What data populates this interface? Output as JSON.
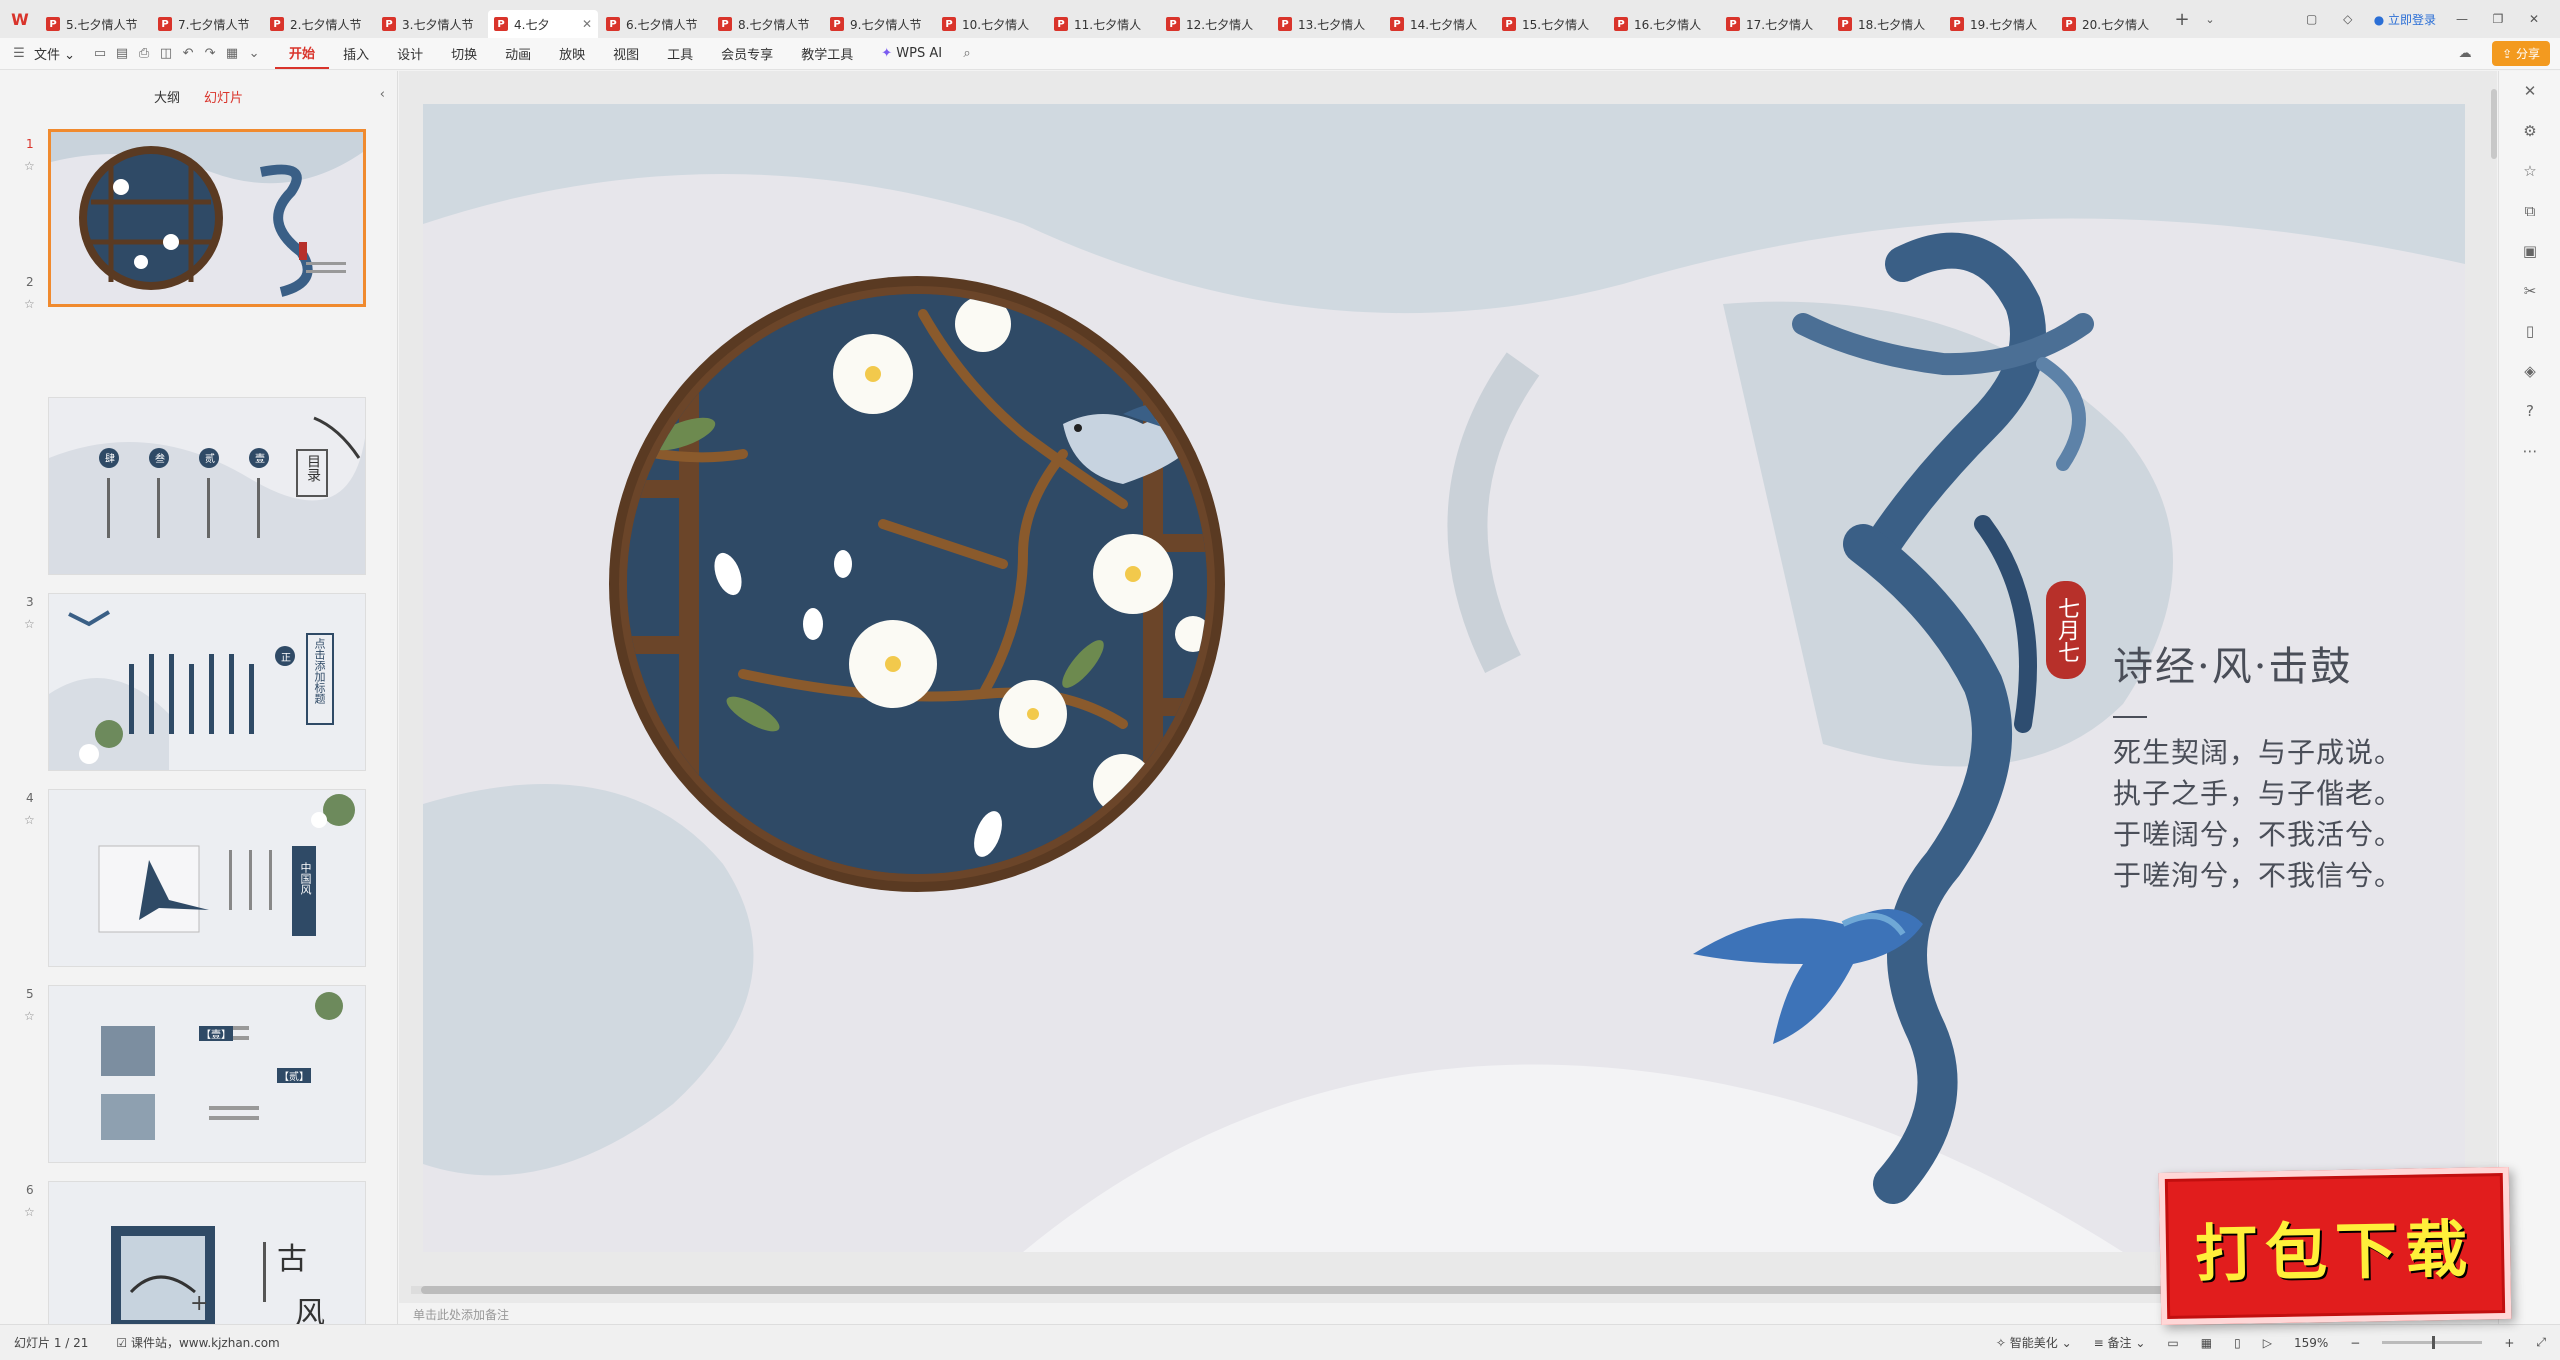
{
  "tabs": [
    {
      "label": "5.七夕情人节"
    },
    {
      "label": "7.七夕情人节"
    },
    {
      "label": "2.七夕情人节"
    },
    {
      "label": "3.七夕情人节"
    },
    {
      "label": "4.七夕"
    },
    {
      "label": "6.七夕情人节"
    },
    {
      "label": "8.七夕情人节"
    },
    {
      "label": "9.七夕情人节"
    },
    {
      "label": "10.七夕情人"
    },
    {
      "label": "11.七夕情人"
    },
    {
      "label": "12.七夕情人"
    },
    {
      "label": "13.七夕情人"
    },
    {
      "label": "14.七夕情人"
    },
    {
      "label": "15.七夕情人"
    },
    {
      "label": "16.七夕情人"
    },
    {
      "label": "17.七夕情人"
    },
    {
      "label": "18.七夕情人"
    },
    {
      "label": "19.七夕情人"
    },
    {
      "label": "20.七夕情人"
    }
  ],
  "titlebar": {
    "login": "立即登录"
  },
  "menu": {
    "file": "文件",
    "items": [
      "开始",
      "插入",
      "设计",
      "切换",
      "动画",
      "放映",
      "视图",
      "工具",
      "会员专享",
      "教学工具"
    ],
    "wps_ai": "WPS AI",
    "share": "分享"
  },
  "left_panel": {
    "tab_outline": "大纲",
    "tab_slides": "幻灯片",
    "slide_numbers": [
      "1",
      "2",
      "3",
      "4",
      "5",
      "6"
    ],
    "add_icon": "+"
  },
  "thumbs": {
    "s2_title": "目录",
    "s2_labels": [
      "肆",
      "叁",
      "贰",
      "壹"
    ],
    "s3_tag": "正",
    "s3_title": "点击添加标题",
    "s4_title": "中国风",
    "s5_tags": [
      "【壹】",
      "【贰】"
    ],
    "s6_chars": [
      "古",
      "风"
    ]
  },
  "slide": {
    "seal": "七月七",
    "poem_title": "诗经·风·击鼓",
    "poem_lines": [
      "死生契阔，与子成说。",
      "执子之手，与子偕老。",
      "于嗟阔兮，不我活兮。",
      "于嗟洵兮，不我信兮。"
    ]
  },
  "notes_placeholder": "单击此处添加备注",
  "download_badge": "打包下载",
  "status": {
    "slide_info": "幻灯片 1 / 21",
    "site": "课件站，www.kjzhan.com",
    "beautify": "智能美化",
    "notes": "备注",
    "zoom": "159%"
  },
  "colors": {
    "accent": "#d9342b",
    "navy": "#2f4a66",
    "frame": "#5a3a22",
    "ink_blue": "#3a5f86"
  }
}
